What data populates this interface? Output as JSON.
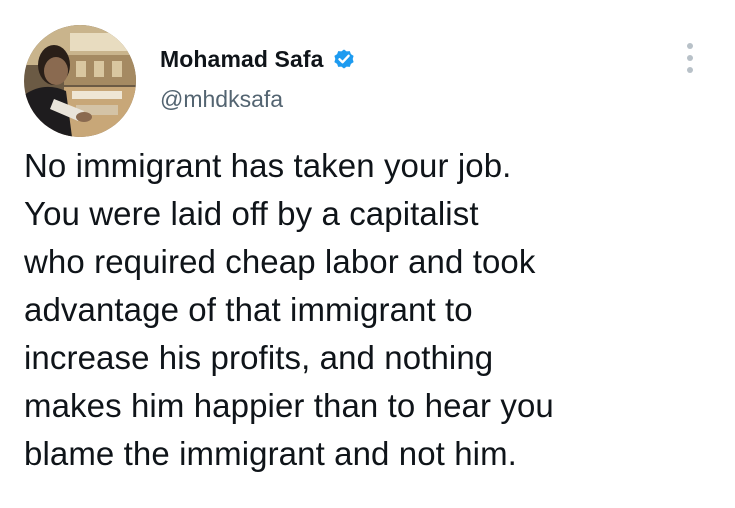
{
  "author": {
    "display_name": "Mohamad Safa",
    "handle": "@mhdksafa",
    "verified": true,
    "avatar_icon": "user-photo",
    "verified_icon": "verified-badge-icon",
    "verified_color": "#1d9bf0"
  },
  "menu": {
    "icon": "more-vertical-icon"
  },
  "tweet": {
    "lines": [
      "No immigrant has taken your job.",
      "You were laid off by a capitalist",
      "who required cheap labor and took",
      "advantage of that immigrant to",
      "increase his profits, and nothing",
      "makes him happier than to hear you",
      "blame the immigrant and not him."
    ]
  },
  "colors": {
    "text": "#0f1419",
    "secondary_text": "#536471",
    "icon_gray": "#b8c1c8"
  }
}
